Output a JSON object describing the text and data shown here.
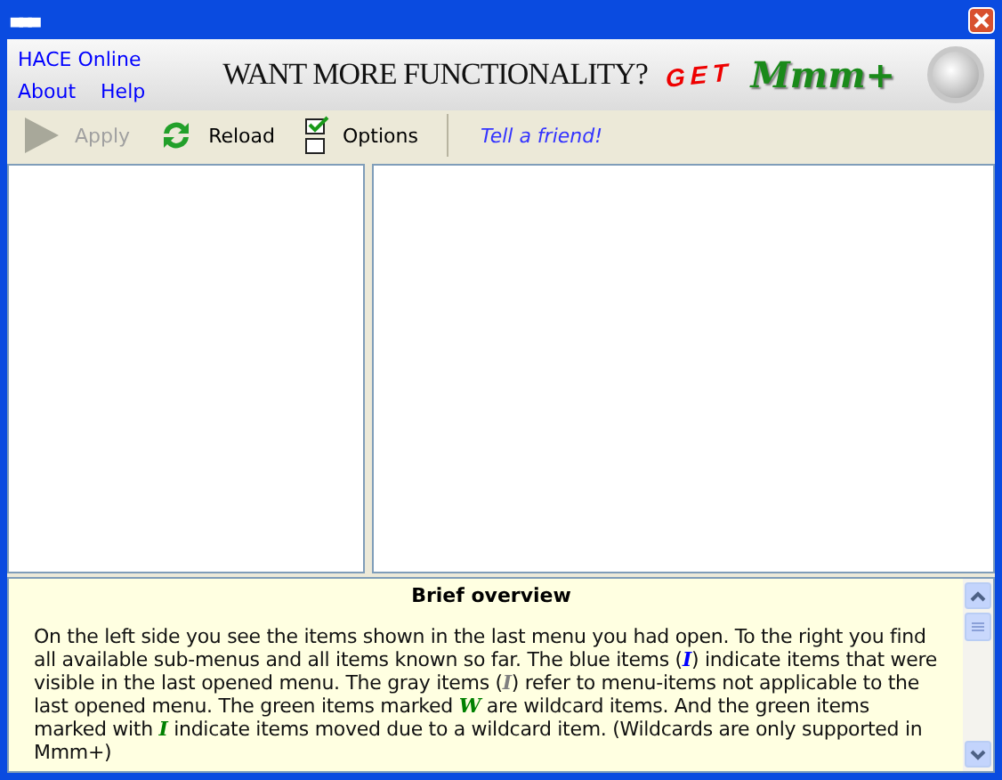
{
  "window": {
    "title_mark": "▄▄▄"
  },
  "menu": {
    "links": [
      {
        "label": "HACE Online"
      },
      {
        "label": "About"
      },
      {
        "label": "Help"
      }
    ]
  },
  "banner": {
    "headline": "WANT MORE FUNCTIONALITY?",
    "get": "GET",
    "product": "Mmm+"
  },
  "toolbar": {
    "buttons": [
      {
        "label": "Apply",
        "kind": "play",
        "disabled": true
      },
      {
        "label": "Reload",
        "kind": "reload",
        "disabled": false
      },
      {
        "label": "Options",
        "kind": "options",
        "disabled": false
      }
    ],
    "link": "Tell a friend!"
  },
  "overview": {
    "title": "Brief overview",
    "segments": [
      {
        "text": "On the left side you see the items shown in the last menu you had open. To the right you find all available sub-menus and all items known so far. The blue items (",
        "kind": "plain"
      },
      {
        "text": "I",
        "kind": "mark",
        "color": "#0000ff"
      },
      {
        "text": ") indicate items that were visible in the last opened menu. The gray items (",
        "kind": "plain"
      },
      {
        "text": "I",
        "kind": "mark",
        "color": "#808080"
      },
      {
        "text": ") refer to menu-items not applicable to the last opened menu. The green items marked ",
        "kind": "plain"
      },
      {
        "text": "W",
        "kind": "mark",
        "color": "#008000"
      },
      {
        "text": " are wildcard items. And the green items marked with ",
        "kind": "plain"
      },
      {
        "text": "I",
        "kind": "mark",
        "color": "#008000"
      },
      {
        "text": " indicate items moved due to a wildcard item. (Wildcards are only supported in Mmm+)",
        "kind": "plain"
      }
    ]
  }
}
